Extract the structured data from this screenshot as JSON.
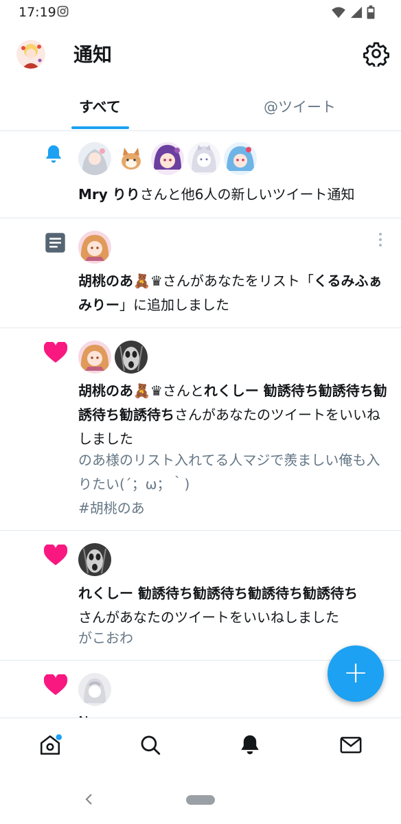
{
  "status_bar": {
    "time": "17:19"
  },
  "header": {
    "title": "通知"
  },
  "tabs": [
    {
      "label": "すべて",
      "active": true
    },
    {
      "label": "@ツイート",
      "active": false
    }
  ],
  "notifications": [
    {
      "type": "bell",
      "bold": "Mry りり",
      "text": "さんと他6人の新しいツイート通知"
    },
    {
      "type": "list",
      "bold1": "胡桃のあ🧸♛",
      "text1": "さんがあなたをリスト「",
      "bold2": "くるみふぁみりー",
      "text2": "」に追加しました"
    },
    {
      "type": "like",
      "bold1": "胡桃のあ🧸♛",
      "text1": "さんと",
      "bold2": "れくしー 勧誘待ち勧誘待ち勧誘待ち勧誘待ち",
      "text2": "さんがあなたのツイートをいいねしました",
      "tweet": "のあ様のリスト入れてる人マジで羨ましい俺も入りたい(´；ω；｀)",
      "tweet_tag": "#胡桃のあ"
    },
    {
      "type": "like",
      "bold": "れくしー 勧誘待ち勧誘待ち勧誘待ち勧誘待ち",
      "text": "さんがあなたのツイートをいいねしました",
      "tweet": "がこおわ"
    },
    {
      "type": "like",
      "partial": "N. .. ...... ........"
    }
  ],
  "colors": {
    "accent": "#1da1f2",
    "like": "#e0245e",
    "muted": "#657786"
  },
  "icons": {
    "fab": "plus",
    "nav": [
      "home-icon",
      "search-icon",
      "bell-icon",
      "mail-icon"
    ]
  }
}
